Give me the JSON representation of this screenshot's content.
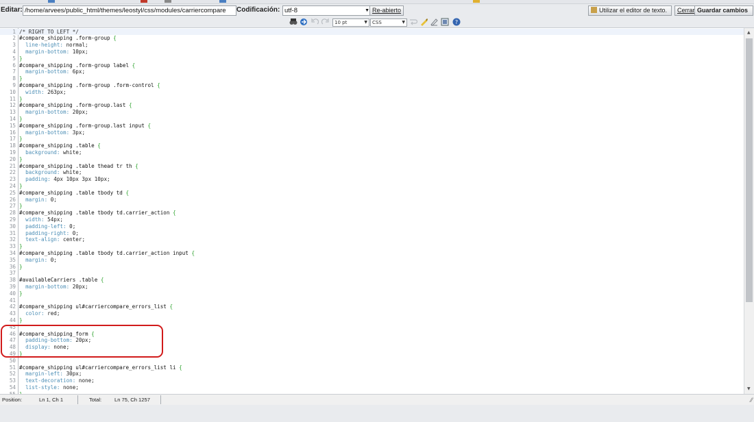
{
  "header": {
    "edit_label": "Editar:",
    "file_path": "/home/arvees/public_html/themes/leostyl/css/modules/carriercompare",
    "encoding_label": "Codificación:",
    "encoding_value": "utf-8",
    "reopen_label": "Re-abierto",
    "text_editor_label": "Utilizar el editor de texto.",
    "close_label": "Cerrar",
    "save_label": "Guardar cambios"
  },
  "toolbar": {
    "font_size": "10 pt",
    "syntax": "CSS"
  },
  "code_lines": [
    "/* RIGHT TO LEFT */",
    "#compare_shipping .form-group {",
    "  line-height: normal;",
    "  margin-bottom: 10px;",
    "}",
    "#compare_shipping .form-group label {",
    "  margin-bottom: 6px;",
    "}",
    "#compare_shipping .form-group .form-control {",
    "  width: 263px;",
    "}",
    "#compare_shipping .form-group.last {",
    "  margin-bottom: 20px;",
    "}",
    "#compare_shipping .form-group.last input {",
    "  margin-bottom: 3px;",
    "}",
    "#compare_shipping .table {",
    "  background: white;",
    "}",
    "#compare_shipping .table thead tr th {",
    "  background: white;",
    "  padding: 4px 10px 3px 10px;",
    "}",
    "#compare_shipping .table tbody td {",
    "  margin: 0;",
    "}",
    "#compare_shipping .table tbody td.carrier_action {",
    "  width: 54px;",
    "  padding-left: 0;",
    "  padding-right: 0;",
    "  text-align: center;",
    "}",
    "#compare_shipping .table tbody td.carrier_action input {",
    "  margin: 0;",
    "}",
    "",
    "#availableCarriers .table {",
    "  margin-bottom: 20px;",
    "}",
    "",
    "#compare_shipping ul#carriercompare_errors_list {",
    "  color: red;",
    "}",
    "",
    "#compare_shipping_form {",
    "  padding-bottom: 20px;",
    "  display: none;",
    "}",
    "",
    "#compare_shipping ul#carriercompare_errors_list li {",
    "  margin-left: 30px;",
    "  text-decoration: none;",
    "  list-style: none;",
    "}"
  ],
  "status": {
    "position_label": "Position:",
    "position_value": "Ln 1, Ch 1",
    "total_label": "Total:",
    "total_value": "Ln 75, Ch 1257"
  },
  "colors": {
    "highlight": "#d11a1a",
    "brace": "#2aa12a",
    "property": "#4a8db5"
  }
}
